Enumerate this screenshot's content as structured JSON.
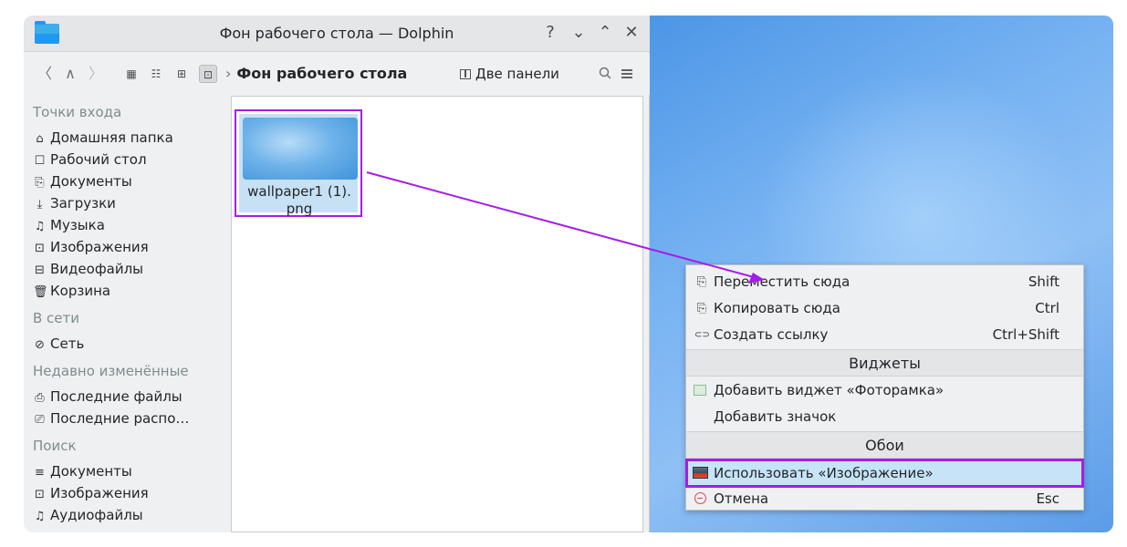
{
  "window": {
    "title": "Фон рабочего стола — Dolphin",
    "buttons": {
      "help": "?",
      "minimize": "⌄",
      "maximize": "⌃",
      "close": "✕"
    }
  },
  "toolbar": {
    "back": "〈",
    "up": "∧",
    "forward": "〉",
    "breadcrumb_sep": "›",
    "current_folder": "Фон рабочего стола",
    "split_label": "Две панели",
    "search_icon": "search-icon",
    "menu_icon": "hamburger-menu-icon"
  },
  "sidebar": {
    "places": {
      "heading": "Точки входа",
      "items": [
        {
          "icon": "⌂",
          "label": "Домашняя папка"
        },
        {
          "icon": "☐",
          "label": "Рабочий стол"
        },
        {
          "icon": "⎘",
          "label": "Документы"
        },
        {
          "icon": "⤓",
          "label": "Загрузки"
        },
        {
          "icon": "♫",
          "label": "Музыка"
        },
        {
          "icon": "⊡",
          "label": "Изображения"
        },
        {
          "icon": "⊟",
          "label": "Видеофайлы"
        },
        {
          "icon": "🗑",
          "label": "Корзина"
        }
      ]
    },
    "network": {
      "heading": "В сети",
      "items": [
        {
          "icon": "⊘",
          "label": "Сеть"
        }
      ]
    },
    "recent": {
      "heading": "Недавно изменённые",
      "items": [
        {
          "icon": "⎙",
          "label": "Последние файлы"
        },
        {
          "icon": "⎚",
          "label": "Последние распо…"
        }
      ]
    },
    "search": {
      "heading": "Поиск",
      "items": [
        {
          "icon": "≡",
          "label": "Документы"
        },
        {
          "icon": "⊡",
          "label": "Изображения"
        },
        {
          "icon": "♫",
          "label": "Аудиофайлы"
        }
      ]
    }
  },
  "file": {
    "name_line1": "wallpaper1 (1).",
    "name_line2": "png"
  },
  "context_menu": {
    "move": {
      "icon": "⎘",
      "label": "Переместить сюда",
      "shortcut": "Shift"
    },
    "copy": {
      "icon": "⎘",
      "label": "Копировать сюда",
      "shortcut": "Ctrl"
    },
    "link": {
      "icon": "⊂⊃",
      "label": "Создать ссылку",
      "shortcut": "Ctrl+Shift"
    },
    "widgets_heading": "Виджеты",
    "add_photo_frame": "Добавить виджет «Фоторамка»",
    "add_icon": "Добавить значок",
    "wallpaper_heading": "Обои",
    "use_image": "Использовать «Изображение»",
    "cancel": {
      "label": "Отмена",
      "shortcut": "Esc"
    }
  },
  "colors": {
    "annotation": "#a31ee6",
    "selection": "#c6e3f7",
    "desktop": "#76b2f2"
  }
}
